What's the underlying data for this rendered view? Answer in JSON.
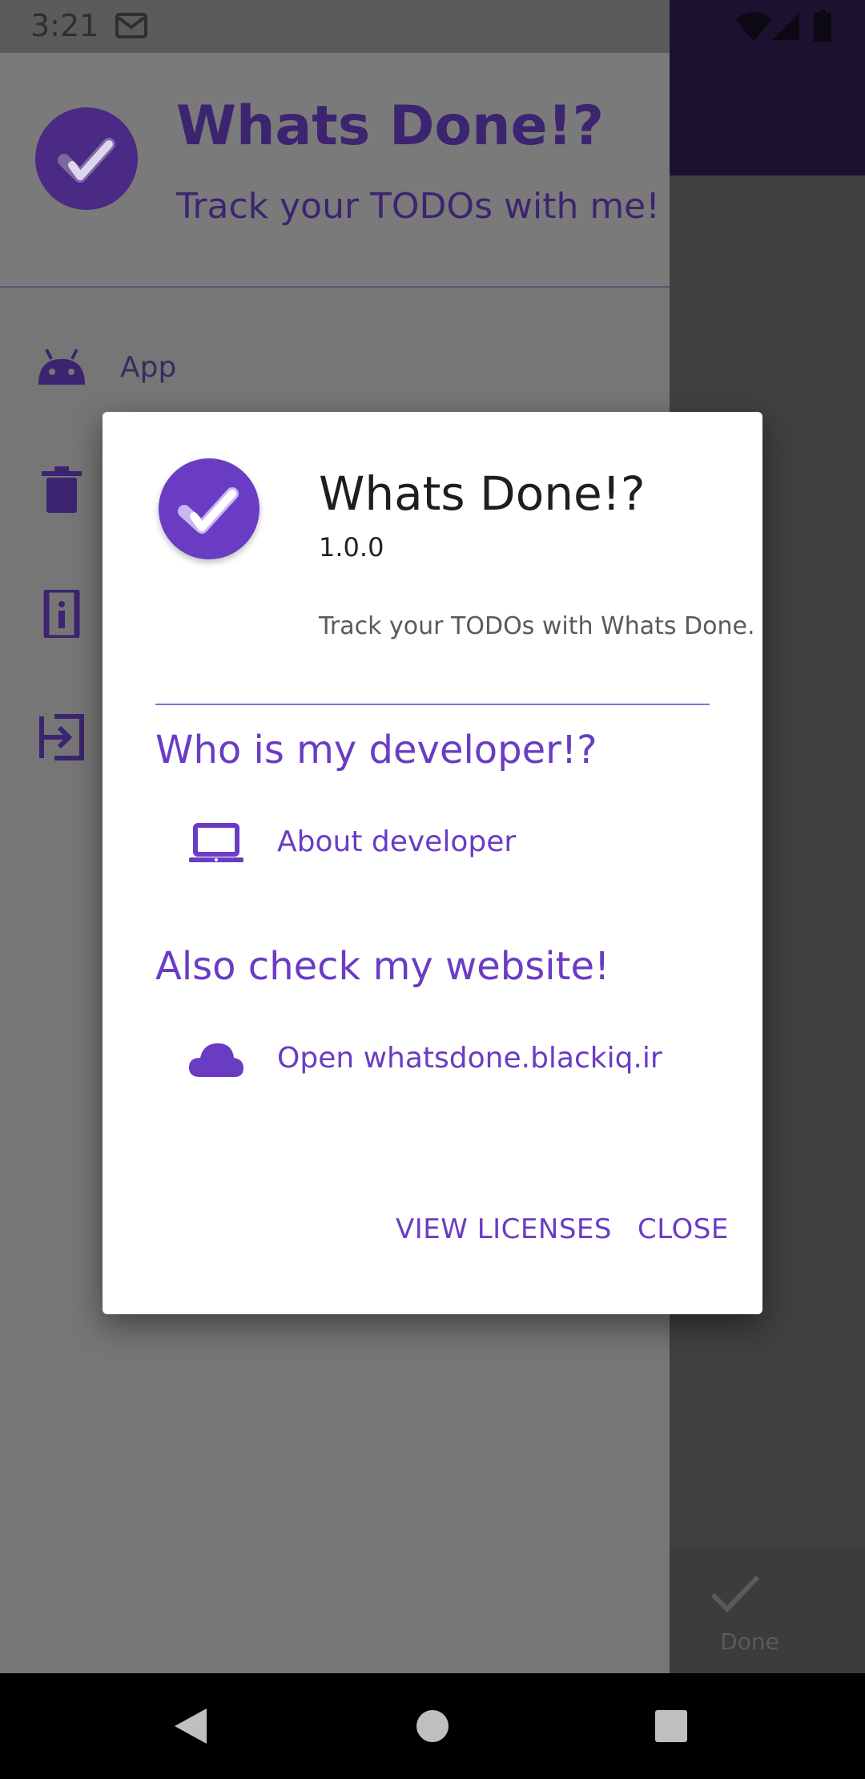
{
  "status_bar": {
    "time": "3:21",
    "icons": [
      "gmail-icon",
      "wifi-icon",
      "signal-icon",
      "battery-icon"
    ]
  },
  "drawer": {
    "title": "Whats Done!?",
    "subtitle": "Track your TODOs with me!",
    "items": [
      {
        "label": "App",
        "icon": "android-icon"
      },
      {
        "label": "",
        "icon": "trash-icon"
      },
      {
        "label": "",
        "icon": "info-icon"
      },
      {
        "label": "",
        "icon": "exit-icon"
      }
    ]
  },
  "background_app": {
    "done_label": "Done"
  },
  "dialog": {
    "title": "Whats Done!?",
    "version": "1.0.0",
    "description": "Track your TODOs with Whats Done.",
    "developer_section": "Who is my developer!?",
    "developer_link": "About developer",
    "website_section": "Also check my website!",
    "website_link": "Open whatsdone.blackiq.ir",
    "buttons": {
      "licenses": "VIEW LICENSES",
      "close": "CLOSE"
    }
  },
  "colors": {
    "accent": "#6a3cc4",
    "toolbar_dark": "#1c1230",
    "scrim": "#767676",
    "text_dark": "#1e1e1e"
  }
}
